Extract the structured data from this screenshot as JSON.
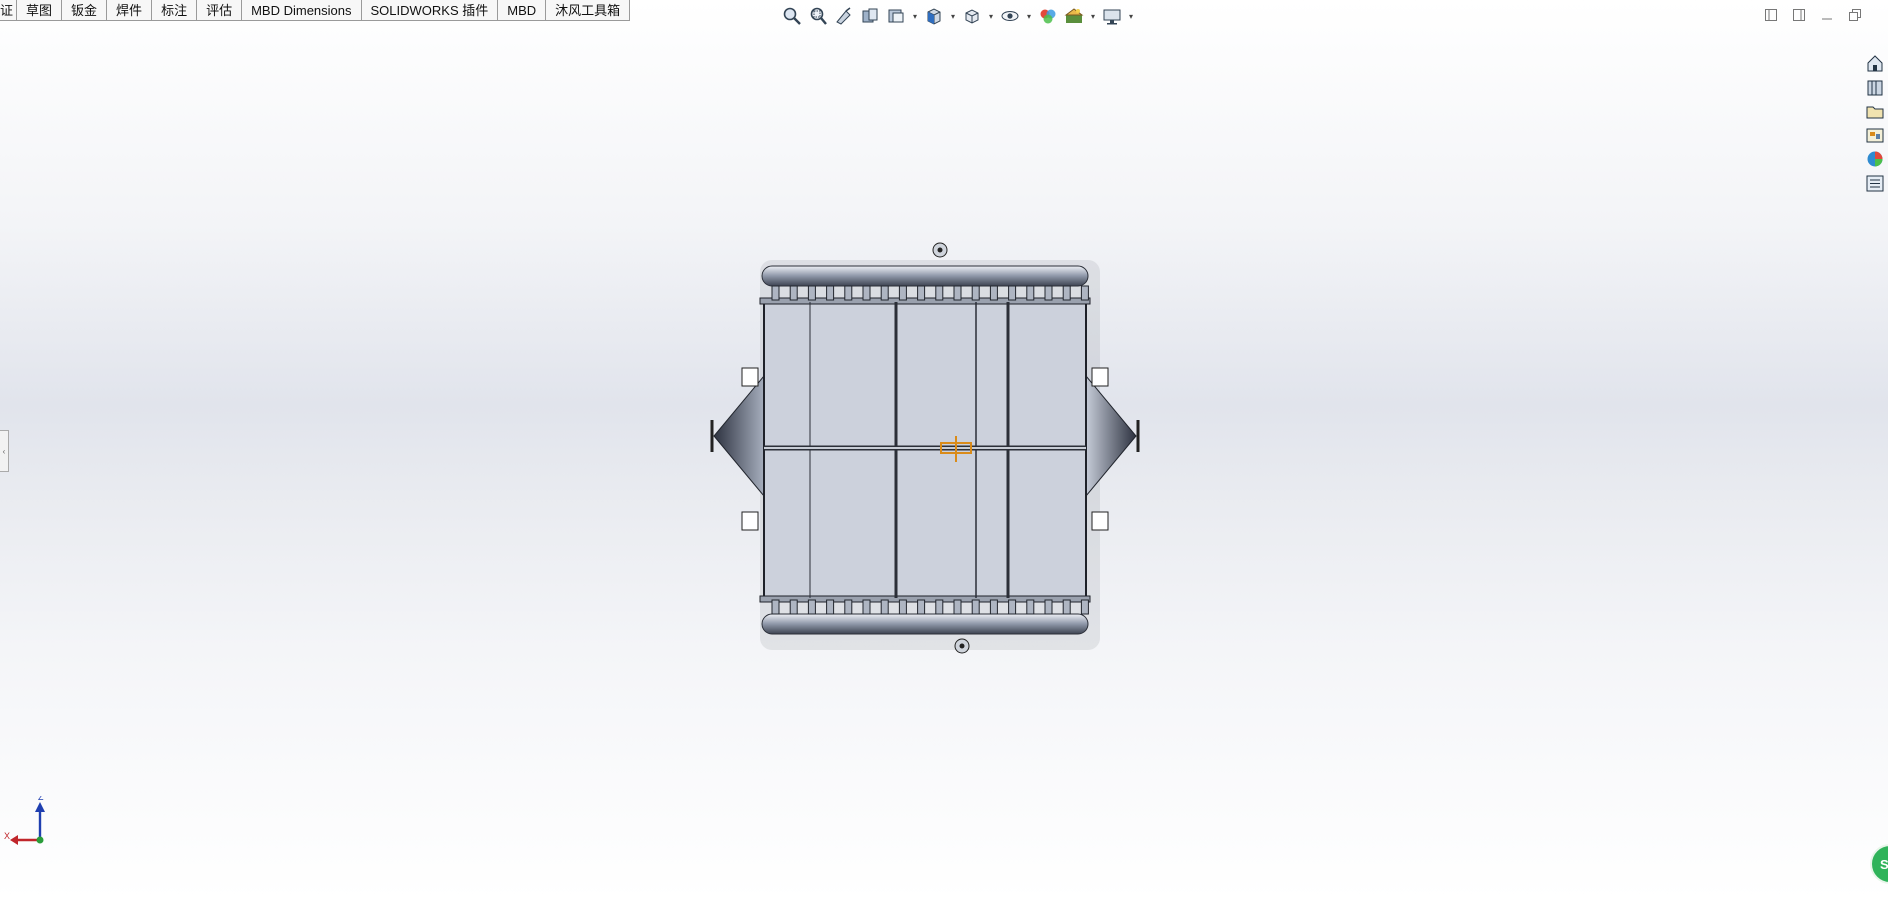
{
  "tabs": [
    {
      "label": "证",
      "id": "tab-feature-partial"
    },
    {
      "label": "草图",
      "id": "tab-sketch"
    },
    {
      "label": "钣金",
      "id": "tab-sheet-metal"
    },
    {
      "label": "焊件",
      "id": "tab-weldments"
    },
    {
      "label": "标注",
      "id": "tab-markup"
    },
    {
      "label": "评估",
      "id": "tab-evaluate"
    },
    {
      "label": "MBD Dimensions",
      "id": "tab-mbd-dimensions"
    },
    {
      "label": "SOLIDWORKS 插件",
      "id": "tab-solidworks-addins"
    },
    {
      "label": "MBD",
      "id": "tab-mbd"
    },
    {
      "label": "沐风工具箱",
      "id": "tab-mufeng-toolbox"
    }
  ],
  "headsup_icons": [
    "zoom-to-fit-icon",
    "zoom-to-area-icon",
    "previous-view-icon",
    "section-view-icon",
    "dynamic-annotation-views-icon",
    "view-orientation-icon",
    "display-style-icon",
    "hide-show-items-icon",
    "edit-appearance-icon",
    "apply-scene-icon",
    "view-settings-icon"
  ],
  "window_controls": [
    "restore-left-icon",
    "restore-right-icon",
    "minimize-icon",
    "restore-icon"
  ],
  "taskpane_icons": [
    "solidworks-resources-icon",
    "design-library-icon",
    "file-explorer-icon",
    "view-palette-icon",
    "appearances-scenes-icon",
    "custom-properties-icon"
  ],
  "triad": {
    "z_label": "Z",
    "x_label": "X"
  },
  "badge": {
    "text": "SZ"
  },
  "colors": {
    "accent": "#d98b1a",
    "axis_x": "#c0262b",
    "axis_z": "#1f3fb0",
    "origin": "#2a9d3a"
  }
}
